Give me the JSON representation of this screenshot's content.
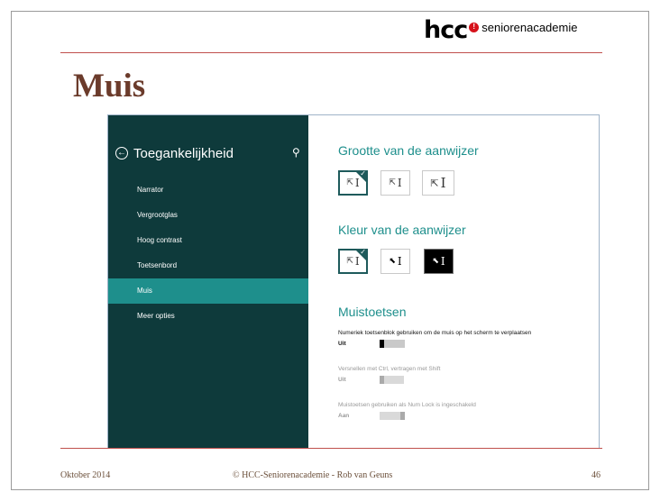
{
  "logo": {
    "brand": "hcc",
    "mark": "!",
    "tagline": "seniorenacademie"
  },
  "slide": {
    "title": "Muis"
  },
  "sidebar": {
    "back_symbol": "←",
    "title": "Toegankelijkheid",
    "items": [
      {
        "label": "Narrator"
      },
      {
        "label": "Vergrootglas"
      },
      {
        "label": "Hoog contrast"
      },
      {
        "label": "Toetsenbord"
      },
      {
        "label": "Muis"
      },
      {
        "label": "Meer opties"
      }
    ]
  },
  "pointer_size": {
    "title": "Grootte van de aanwijzer",
    "options": [
      "I",
      "I",
      "I"
    ],
    "selected": 0
  },
  "pointer_color": {
    "title": "Kleur van de aanwijzer",
    "options": [
      "I",
      "I",
      "I"
    ],
    "selected": 0
  },
  "mouse_keys": {
    "title": "Muistoetsen",
    "settings": [
      {
        "label": "Numeriek toetsenblok gebruiken om de muis op het scherm te verplaatsen",
        "state": "Uit",
        "value": false,
        "enabled": true
      },
      {
        "label": "Versnellen met Ctrl, vertragen met Shift",
        "state": "Uit",
        "value": false,
        "enabled": false
      },
      {
        "label": "Muistoetsen gebruiken als Num Lock is ingeschakeld",
        "state": "Aan",
        "value": true,
        "enabled": false
      }
    ]
  },
  "footer": {
    "date": "Oktober 2014",
    "credit": "© HCC-Seniorenacademie - Rob van Geuns",
    "page": "46"
  },
  "colors": {
    "sidebar_bg": "#0e3a3b",
    "accent": "#1e8f8c",
    "title": "#6b3b2b",
    "rule": "#c0504d"
  },
  "icons": {
    "back": "back-arrow-icon",
    "search": "search-icon",
    "check": "check-icon"
  }
}
